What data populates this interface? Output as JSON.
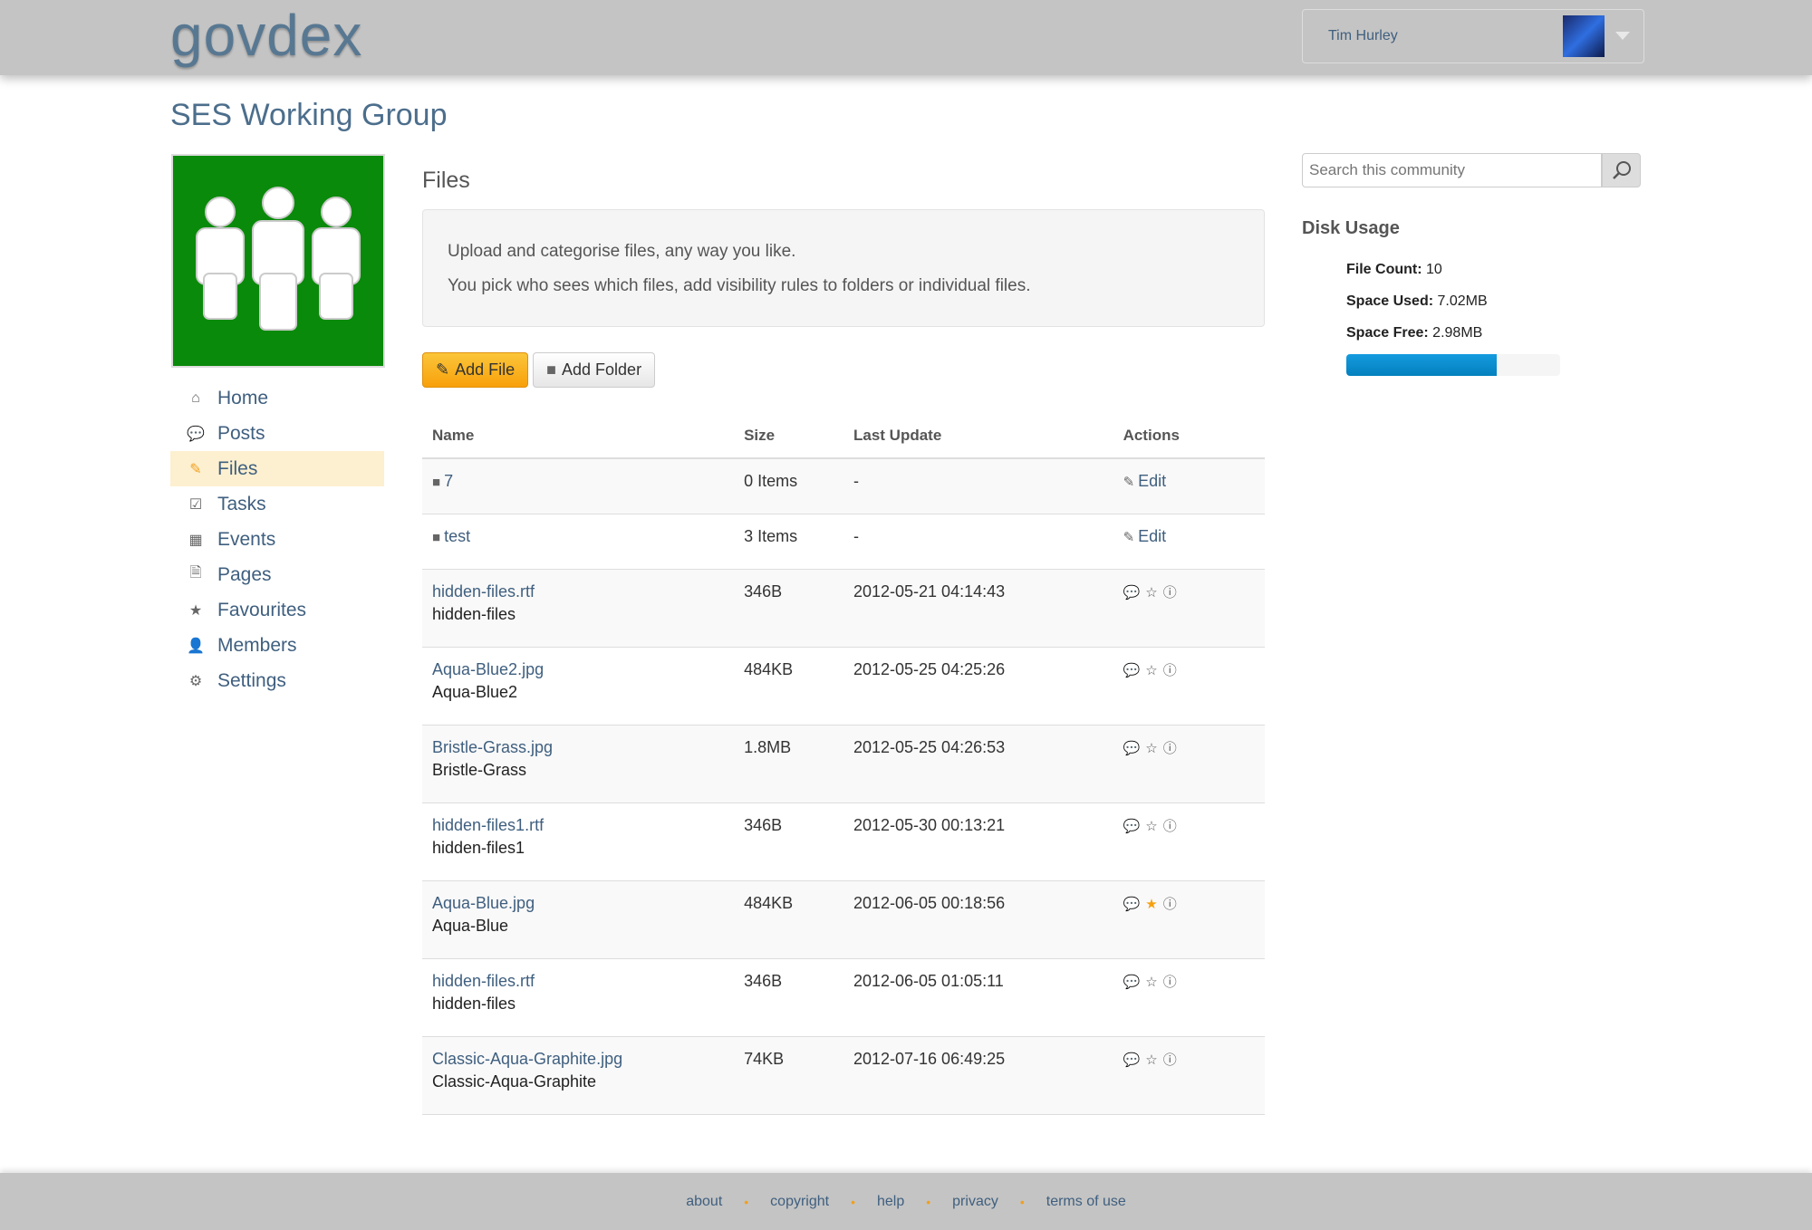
{
  "header": {
    "logo": "govdex",
    "user_name": "Tim Hurley"
  },
  "group": {
    "title": "SES Working Group"
  },
  "nav": [
    {
      "label": "Home",
      "icon": "home-icon",
      "glyph": "⌂"
    },
    {
      "label": "Posts",
      "icon": "comment-icon",
      "glyph": "💬"
    },
    {
      "label": "Files",
      "icon": "paperclip-icon",
      "glyph": "✎",
      "active": true
    },
    {
      "label": "Tasks",
      "icon": "check-icon",
      "glyph": "☑"
    },
    {
      "label": "Events",
      "icon": "calendar-icon",
      "glyph": "▦"
    },
    {
      "label": "Pages",
      "icon": "file-icon",
      "glyph": "🗎"
    },
    {
      "label": "Favourites",
      "icon": "star-icon",
      "glyph": "★"
    },
    {
      "label": "Members",
      "icon": "user-icon",
      "glyph": "👤"
    },
    {
      "label": "Settings",
      "icon": "cog-icon",
      "glyph": "⚙"
    }
  ],
  "main": {
    "title": "Files",
    "info_line1": "Upload and categorise files, any way you like.",
    "info_line2": "You pick who sees which files, add visibility rules to folders or individual files.",
    "add_file": "Add File",
    "add_folder": "Add Folder",
    "columns": [
      "Name",
      "Size",
      "Last Update",
      "Actions"
    ],
    "folders": [
      {
        "name": "7",
        "size": "0 Items",
        "updated": "-",
        "action": "Edit"
      },
      {
        "name": "test",
        "size": "3 Items",
        "updated": "-",
        "action": "Edit"
      }
    ],
    "files": [
      {
        "name": "hidden-files.rtf",
        "title": "hidden-files",
        "size": "346B",
        "updated": "2012-05-21 04:14:43",
        "favourite": false
      },
      {
        "name": "Aqua-Blue2.jpg",
        "title": "Aqua-Blue2",
        "size": "484KB",
        "updated": "2012-05-25 04:25:26",
        "favourite": false
      },
      {
        "name": "Bristle-Grass.jpg",
        "title": "Bristle-Grass",
        "size": "1.8MB",
        "updated": "2012-05-25 04:26:53",
        "favourite": false
      },
      {
        "name": "hidden-files1.rtf",
        "title": "hidden-files1",
        "size": "346B",
        "updated": "2012-05-30 00:13:21",
        "favourite": false
      },
      {
        "name": "Aqua-Blue.jpg",
        "title": "Aqua-Blue",
        "size": "484KB",
        "updated": "2012-06-05 00:18:56",
        "favourite": true
      },
      {
        "name": "hidden-files.rtf",
        "title": "hidden-files",
        "size": "346B",
        "updated": "2012-06-05 01:05:11",
        "favourite": false
      },
      {
        "name": "Classic-Aqua-Graphite.jpg",
        "title": "Classic-Aqua-Graphite",
        "size": "74KB",
        "updated": "2012-07-16 06:49:25",
        "favourite": false
      }
    ]
  },
  "sidebar_right": {
    "search_placeholder": "Search this community",
    "disk_title": "Disk Usage",
    "file_count_label": "File Count:",
    "file_count": "10",
    "space_used_label": "Space Used:",
    "space_used": "7.02MB",
    "space_free_label": "Space Free:",
    "space_free": "2.98MB",
    "usage_percent": 70.2
  },
  "footer": [
    "about",
    "copyright",
    "help",
    "privacy",
    "terms of use"
  ],
  "colors": {
    "accent": "#f8a00a",
    "link": "#3f5f7f",
    "bar": "#149bdf",
    "logo_bg": "#0a8a0a"
  }
}
